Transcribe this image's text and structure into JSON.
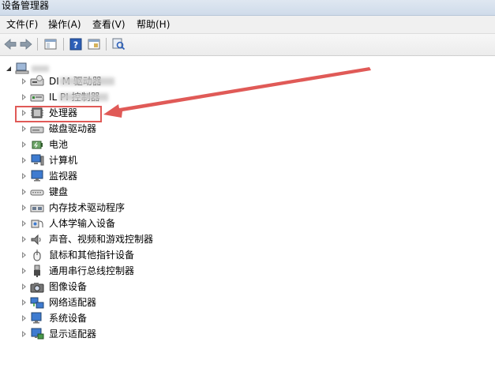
{
  "window": {
    "title": "设备管理器"
  },
  "menu": [
    "文件(F)",
    "操作(A)",
    "查看(V)",
    "帮助(H)"
  ],
  "toolbar": {
    "buttons": [
      "back-icon",
      "forward-icon",
      "show-hide-console-tree-icon",
      "help-icon",
      "properties-icon",
      "scan-hardware-icon"
    ]
  },
  "tree": {
    "root_label": "",
    "items": [
      {
        "label": "DI          M 驱动器",
        "icon": "dvd-drive-icon"
      },
      {
        "label": "IL          PI 控制器",
        "icon": "ide-controller-icon"
      },
      {
        "label": "处理器",
        "icon": "processor-icon"
      },
      {
        "label": "磁盘驱动器",
        "icon": "disk-drive-icon"
      },
      {
        "label": "电池",
        "icon": "battery-icon"
      },
      {
        "label": "计算机",
        "icon": "computer-icon"
      },
      {
        "label": "监视器",
        "icon": "monitor-icon"
      },
      {
        "label": "键盘",
        "icon": "keyboard-icon"
      },
      {
        "label": "内存技术驱动程序",
        "icon": "memory-icon"
      },
      {
        "label": "人体学输入设备",
        "icon": "hid-icon"
      },
      {
        "label": "声音、视频和游戏控制器",
        "icon": "sound-icon"
      },
      {
        "label": "鼠标和其他指针设备",
        "icon": "mouse-icon"
      },
      {
        "label": "通用串行总线控制器",
        "icon": "usb-icon"
      },
      {
        "label": "图像设备",
        "icon": "camera-icon"
      },
      {
        "label": "网络适配器",
        "icon": "network-icon"
      },
      {
        "label": "系统设备",
        "icon": "system-icon"
      },
      {
        "label": "显示适配器",
        "icon": "display-adapter-icon"
      }
    ]
  },
  "annotation": {
    "highlight_color": "#e05a57"
  }
}
